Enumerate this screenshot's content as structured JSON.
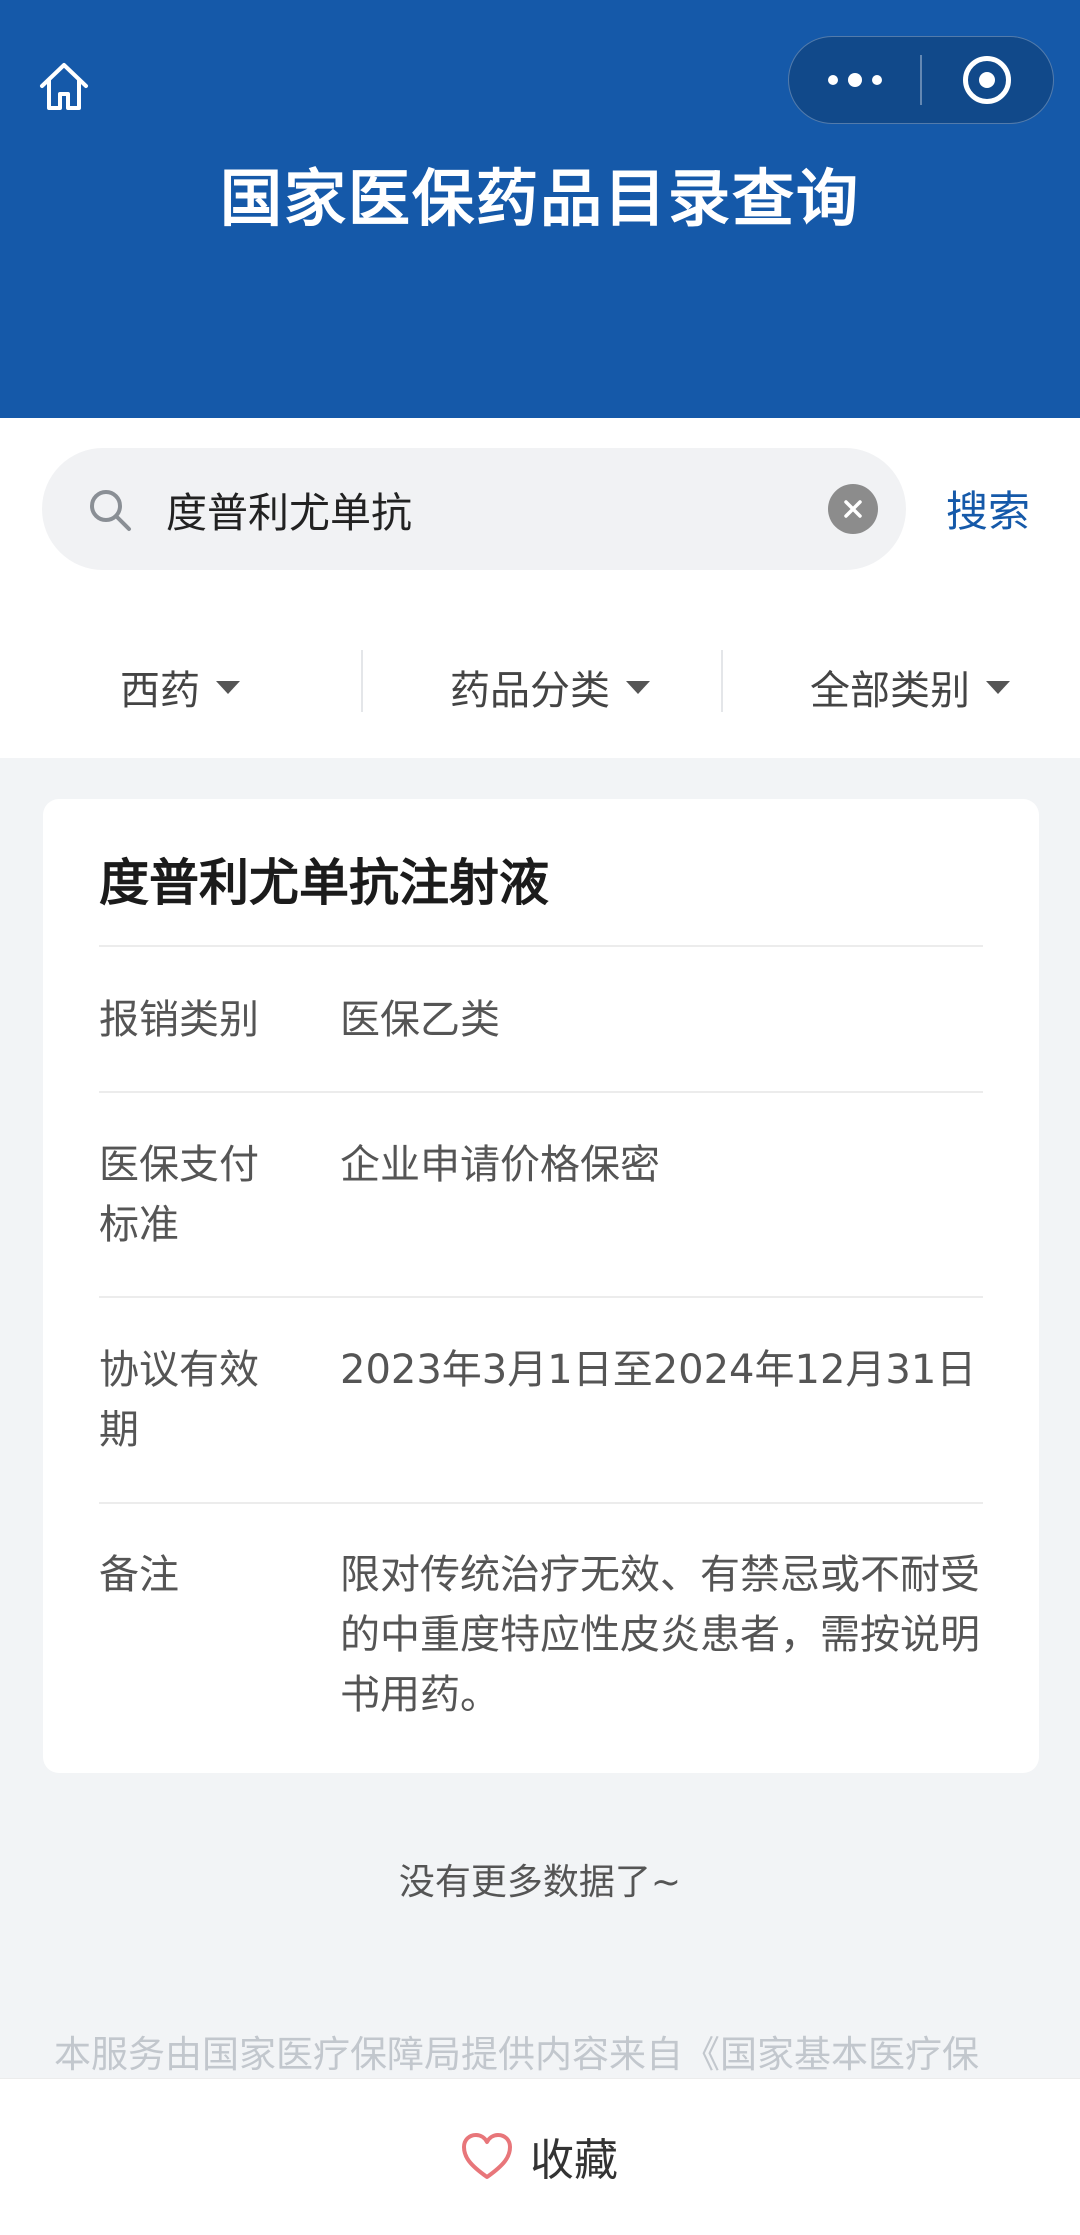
{
  "header": {
    "title": "国家医保药品目录查询",
    "bg_color": "#1559a9",
    "home_icon": "home-icon",
    "more_icon": "more-dots-icon",
    "close_icon": "target-icon"
  },
  "search": {
    "value": "度普利尤单抗",
    "placeholder": "",
    "button_label": "搜索"
  },
  "filters": [
    {
      "label": "西药"
    },
    {
      "label": "药品分类"
    },
    {
      "label": "全部类别"
    }
  ],
  "result": {
    "name": "度普利尤单抗注射液",
    "rows": [
      {
        "label": "报销类别",
        "value": "医保乙类"
      },
      {
        "label": "医保支付标准",
        "value": "企业申请价格保密"
      },
      {
        "label": "协议有效期",
        "value": "2023年3月1日至2024年12月31日"
      },
      {
        "label": "备注",
        "value": "限对传统治疗无效、有禁忌或不耐受的中重度特应性皮炎患者，需按说明书用药。"
      }
    ]
  },
  "no_more_text": "没有更多数据了~",
  "footer_note": "本服务由国家医疗保障局提供内容来自《国家基本医疗保",
  "bottom": {
    "favorite_label": "收藏",
    "favorite_icon": "heart-icon",
    "accent": "#e8767a"
  }
}
